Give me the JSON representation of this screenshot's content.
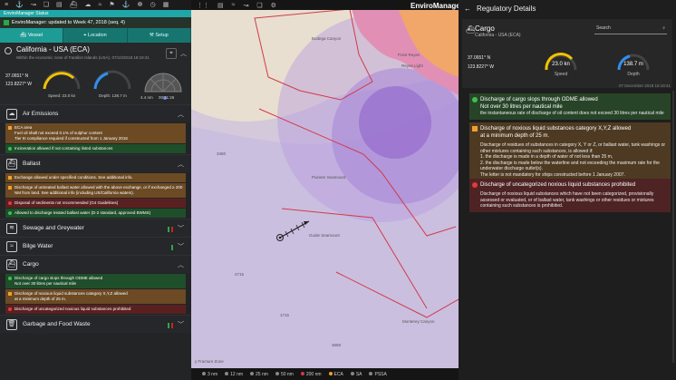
{
  "toolbar": {
    "icons": [
      "list-icon",
      "anchor-icon",
      "route-icon",
      "layers-icon",
      "chart-icon",
      "ship-icon",
      "weather-icon",
      "tide-icon",
      "flag-icon",
      "anchor-icon",
      "wheel-icon",
      "clock-icon",
      "grid-icon"
    ],
    "glyphs": [
      "≡",
      "⚓",
      "↝",
      "❏",
      "▤",
      "⛴",
      "☁",
      "≈",
      "⚑",
      "⚓",
      "☸",
      "◷",
      "▦"
    ]
  },
  "status": {
    "title": "EnviroManager Status",
    "message": "EnviroManager: updated to Week 47, 2018 (seq. 4)"
  },
  "tabs": [
    {
      "label": "Vessel",
      "icon": "ship-icon"
    },
    {
      "label": "Location",
      "icon": "location-icon"
    },
    {
      "label": "Setup",
      "icon": "tools-icon"
    }
  ],
  "location": {
    "title": "California - USA (ECA)",
    "subtitle": "Within the economic zone of Farallon Islands (USA). 07/12/2018 15:19:41",
    "lat": "37.0651° N",
    "lon": "123.8227° W",
    "speed_label": "Speed:",
    "speed_value": "23.0 kn",
    "depth_label": "Depth:",
    "depth_value": "138.7 m",
    "sonar_range": "4.4 nm",
    "sonar_time": "00:11:26"
  },
  "sections": {
    "air": {
      "label": "Air Emissions",
      "rule1_title": "ECA area",
      "rule1_l2": "Fuel oil shall not exceed 0.1% of sulphur content",
      "rule1_l3": "Tier III compliance required if constructed from 1 January 2016",
      "rule2": "Incineration allowed if not containing listed substances"
    },
    "ballast": {
      "label": "Ballast",
      "rule1": "Exchange allowed under specified conditions. See additional info.",
      "rule2": "Discharge of untreated ballast water allowed with the above exchange, or if exchanged ≥ 200 NM from land. See additional info (including US/California waters).",
      "rule3": "Disposal of sediments not recommended (G4 Guidelines)",
      "rule4": "Allowed to discharge treated ballast water (D-2 standard, approved BWMS)"
    },
    "sewage": {
      "label": "Sewage and Greywater"
    },
    "bilge": {
      "label": "Bilge Water"
    },
    "cargo": {
      "label": "Cargo",
      "rule1_title": "Discharge of cargo slops through ODME allowed",
      "rule1_l2": "Not over 30 litres per nautical mile",
      "rule2_title": "Discharge of noxious liquid substances category X,Y,Z allowed",
      "rule2_l2": "at a minimum depth of 25 m.",
      "rule3": "Discharge of uncategorized noxious liquid substances prohibited"
    },
    "garbage": {
      "label": "Garbage and Food Waste"
    }
  },
  "map": {
    "brand": "EnviroManager",
    "labels": {
      "bodega": "Bodega Canyon",
      "pioneer": "Pioneer Seamount",
      "guide": "Guide Seamount",
      "monterey": "Monterey Canyon",
      "fracture": "y Fracture Zone",
      "d3450": "3450",
      "d2715": "2715",
      "d1715": "1715",
      "d3558": "3558",
      "point_reyes": "Point Reyes",
      "reyes_light": "Reyes Light"
    },
    "scale": [
      "3 nm",
      "12 nm",
      "25 nm",
      "50 nm",
      "200 nm",
      "ECA",
      "SA",
      "PSSA"
    ]
  },
  "regulatory": {
    "title": "Regulatory Details",
    "category": "Cargo",
    "region": "California - USA (ECA)",
    "search_placeholder": "Search",
    "lat": "37.0651° N",
    "lon": "123.8227° W",
    "speed_value": "23.0 kn",
    "speed_label": "Speed",
    "depth_value": "138.7 m",
    "depth_label": "Depth",
    "timestamp": "07 December 2018 15:19:41",
    "rule1_head": "Discharge of cargo slops through ODME allowed",
    "rule1_sub": "Not over 30 litres per nautical mile",
    "rule1_body": "the instantaneous rate of discharge of oil content does not exceed 30 litres per nautical mile",
    "rule2_head": "Discharge of noxious liquid substances category X,Y,Z allowed",
    "rule2_sub": "at a minimum depth of 25 m.",
    "rule2_body1": "Discharge of residues of substances in category X, Y or Z, or ballast water, tank washings or other mixtures containing such substances, is allowed if:",
    "rule2_body2": "1. the discharge is made in a depth of water of not less than 25 m,",
    "rule2_body3": "2. the discharge is made below the waterline and not exceeding the maximum rate for the underwater discharge outlet(s).",
    "rule2_body4": "The letter is not mandatory for ships constructed before 1 January 2007.",
    "rule3_head": "Discharge of uncategorized noxious liquid substances prohibited",
    "rule3_body": "Discharge of noxious liquid substances which have not been categorized, provisionally assessed or evaluated, or of ballast water, tank washings or other residues or mixtures containing such substances is prohibited."
  },
  "colors": {
    "teal": "#1c9c94",
    "green": "#3bbf55",
    "orange": "#f0a030",
    "red": "#e23a3a",
    "eca_purple": "#b07ad0",
    "speed_yellow": "#f2c200",
    "depth_blue": "#2f8ff0"
  }
}
